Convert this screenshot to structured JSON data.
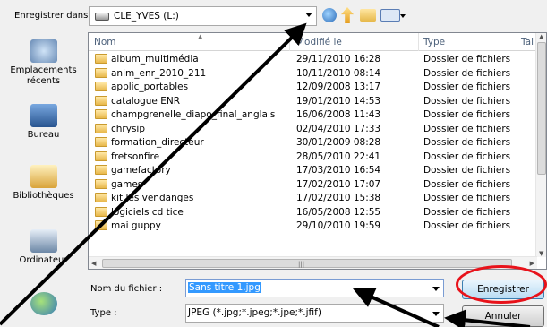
{
  "toolbar": {
    "save_in_label": "Enregistrer dans :",
    "location": "CLE_YVES (L:)"
  },
  "places": [
    {
      "label": "Emplacements récents",
      "icon": "recent-places-icon"
    },
    {
      "label": "Bureau",
      "icon": "desktop-icon"
    },
    {
      "label": "Bibliothèques",
      "icon": "libraries-icon"
    },
    {
      "label": "Ordinateur",
      "icon": "computer-icon"
    },
    {
      "label": "",
      "icon": "network-icon"
    }
  ],
  "file_list": {
    "columns": [
      "Nom",
      "Modifié le",
      "Type",
      "Tai"
    ],
    "rows": [
      {
        "name": "album_multimédia",
        "modified": "29/11/2010 16:28",
        "type": "Dossier de fichiers"
      },
      {
        "name": "anim_enr_2010_211",
        "modified": "10/11/2010 08:14",
        "type": "Dossier de fichiers"
      },
      {
        "name": "applic_portables",
        "modified": "12/09/2008 13:17",
        "type": "Dossier de fichiers"
      },
      {
        "name": "catalogue ENR",
        "modified": "19/01/2010 14:53",
        "type": "Dossier de fichiers"
      },
      {
        "name": "champgrenelle_diapo_final_anglais",
        "modified": "16/06/2008 11:43",
        "type": "Dossier de fichiers"
      },
      {
        "name": "chrysip",
        "modified": "02/04/2010 17:33",
        "type": "Dossier de fichiers"
      },
      {
        "name": "formation_directeur",
        "modified": "30/01/2009 08:28",
        "type": "Dossier de fichiers"
      },
      {
        "name": "fretsonfire",
        "modified": "28/05/2010 22:41",
        "type": "Dossier de fichiers"
      },
      {
        "name": "gamefactory",
        "modified": "17/03/2010 16:54",
        "type": "Dossier de fichiers"
      },
      {
        "name": "games",
        "modified": "17/02/2010 17:07",
        "type": "Dossier de fichiers"
      },
      {
        "name": "kit les vendanges",
        "modified": "17/02/2010 15:38",
        "type": "Dossier de fichiers"
      },
      {
        "name": "logiciels cd tice",
        "modified": "16/05/2008 12:55",
        "type": "Dossier de fichiers"
      },
      {
        "name": "mai guppy",
        "modified": "29/10/2010 19:59",
        "type": "Dossier de fichiers"
      }
    ]
  },
  "form": {
    "filename_label": "Nom du fichier :",
    "filename_value": "Sans titre 1.jpg",
    "type_label": "Type :",
    "type_value": "JPEG (*.jpg;*.jpeg;*.jpe;*.jfif)"
  },
  "buttons": {
    "save": "Enregistrer",
    "cancel": "Annuler"
  },
  "colors": {
    "selection": "#3399ff",
    "highlight_circle": "#e8121a",
    "arrow": "#000000"
  }
}
